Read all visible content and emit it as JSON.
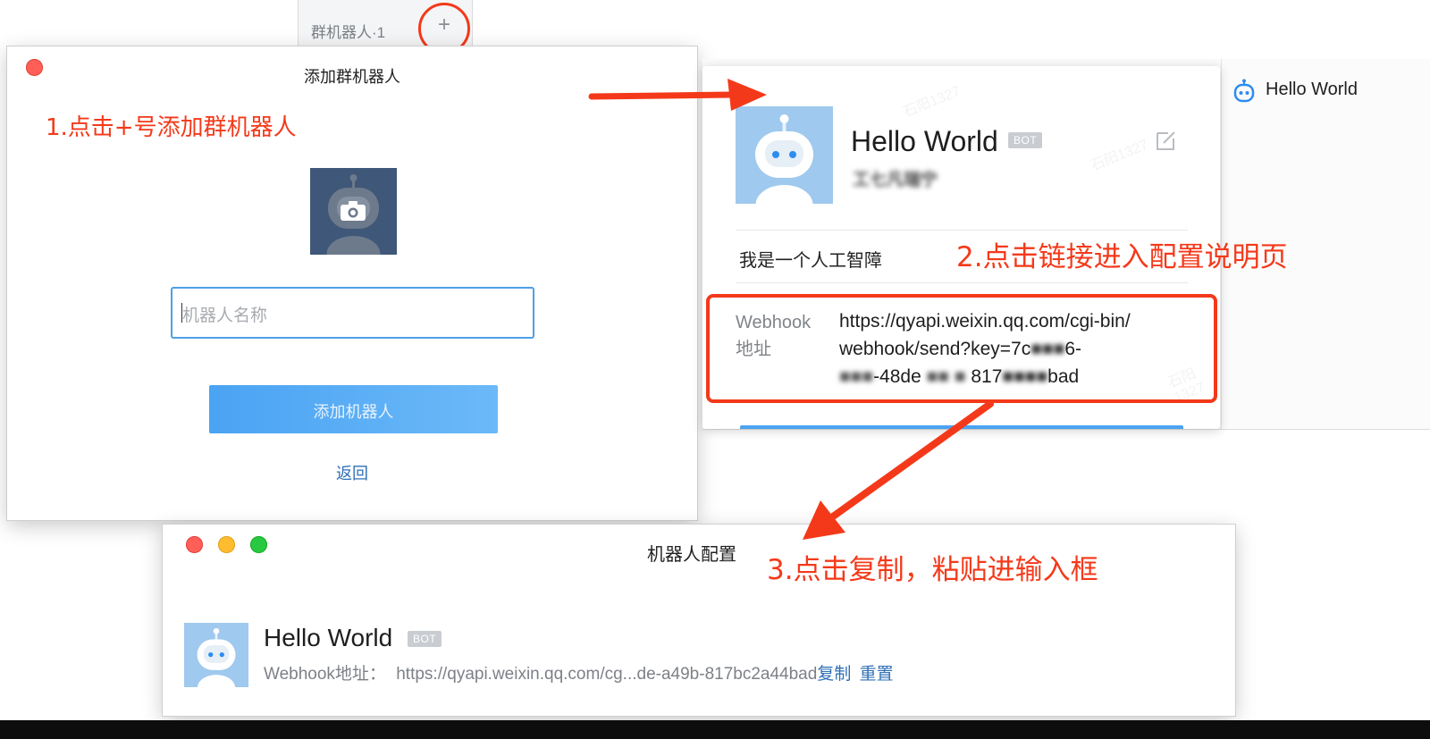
{
  "background_panel": {
    "group_robot_label": "群机器人·1",
    "add_symbol": "+"
  },
  "add_dialog": {
    "title": "添加群机器人",
    "name_placeholder": "机器人名称",
    "submit_label": "添加机器人",
    "back_label": "返回"
  },
  "bot_card": {
    "name": "Hello World",
    "badge": "BOT",
    "subtitle_masked": "工七凡瑞宁",
    "description": "我是一个人工智障",
    "webhook_label_line1": "Webhook",
    "webhook_label_line2": "地址",
    "webhook_url_line1": "https://qyapi.weixin.qq.com/cgi-bin/",
    "webhook_url_line2": "webhook/send?key=7c",
    "webhook_url_line2_masked": "■■■",
    "webhook_url_line2_tail": "6-",
    "webhook_url_line3_masked_a": "■■■",
    "webhook_url_line3_mid": "-48de",
    "webhook_url_line3_masked_b": "■■ ■",
    "webhook_url_line3_mid2": " 817",
    "webhook_url_line3_masked_c": "■■■■",
    "webhook_url_line3_tail": "bad",
    "watermark": "石阳1327"
  },
  "sidebar_item": {
    "label": "Hello World"
  },
  "config_window": {
    "title": "机器人配置",
    "bot_name": "Hello World",
    "badge": "BOT",
    "webhook_label": "Webhook地址：",
    "webhook_url": "https://qyapi.weixin.qq.com/cg...de-a49b-817bc2a44bad",
    "copy_label": "复制",
    "reset_label": "重置"
  },
  "annotations": {
    "step1": "1.点击+号添加群机器人",
    "step2": "2.点击链接进入配置说明页",
    "step3": "3.点击复制，粘贴进输入框"
  },
  "colors": {
    "annotation_red": "#f4391a",
    "link_blue": "#2f6fb5",
    "primary_button": "#58aef7",
    "avatar_blue": "#9fc9ee"
  }
}
